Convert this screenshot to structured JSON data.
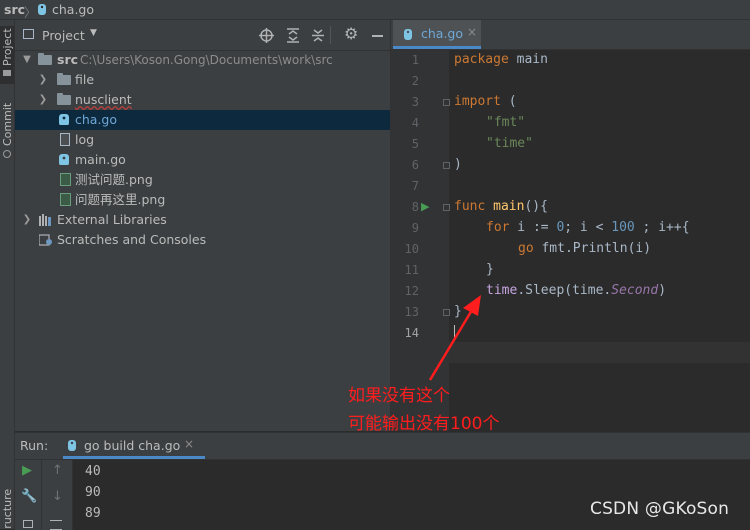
{
  "navbar": {
    "root": "src",
    "file": "cha.go"
  },
  "left_strip": {
    "project_tab": "Project",
    "commit_tab": "Commit",
    "structure_tab": "Structure"
  },
  "project_panel": {
    "title": "Project",
    "tree": {
      "root_name": "src",
      "root_path": "C:\\Users\\Koson.Gong\\Documents\\work\\src",
      "items": [
        {
          "label": "file"
        },
        {
          "label": "nusclient"
        },
        {
          "label": "cha.go"
        },
        {
          "label": "log"
        },
        {
          "label": "main.go"
        },
        {
          "label": "测试问题.png"
        },
        {
          "label": "问题再这里.png"
        }
      ],
      "external_libraries": "External Libraries",
      "scratches": "Scratches and Consoles"
    }
  },
  "editor": {
    "tab": "cha.go",
    "line_numbers": [
      "1",
      "2",
      "3",
      "4",
      "5",
      "6",
      "7",
      "8",
      "9",
      "10",
      "11",
      "12",
      "13",
      "14"
    ],
    "code": {
      "l1_kw": "package",
      "l1_rest": " main",
      "l3_kw": "import",
      "l3_rest": " (",
      "l4_str": "\"fmt\"",
      "l5_str": "\"time\"",
      "l6": ")",
      "l8_kw": "func",
      "l8_fn": "main",
      "l8_rest": "(){",
      "l9_kw": "for",
      "l9_a": " i := ",
      "l9_n0": "0",
      "l9_b": "; i < ",
      "l9_n100": "100",
      "l9_c": " ; i++{",
      "l10_kw": "go",
      "l10_rest": " fmt.Println(i)",
      "l11": "}",
      "l12_a": "time",
      "l12_b": ".Sleep(time.",
      "l12_it": "Second",
      "l12_c": ")",
      "l13": "}"
    }
  },
  "annotation": {
    "line1": "如果没有这个",
    "line2": "可能输出没有100个"
  },
  "run_panel": {
    "label": "Run:",
    "tab": "go build cha.go",
    "output": [
      "40",
      "90",
      "89"
    ]
  },
  "watermark": "CSDN @GKoSon",
  "colors": {
    "accent": "#4a88c7",
    "annotation": "#ff1d1d",
    "selection": "#0d293e"
  }
}
